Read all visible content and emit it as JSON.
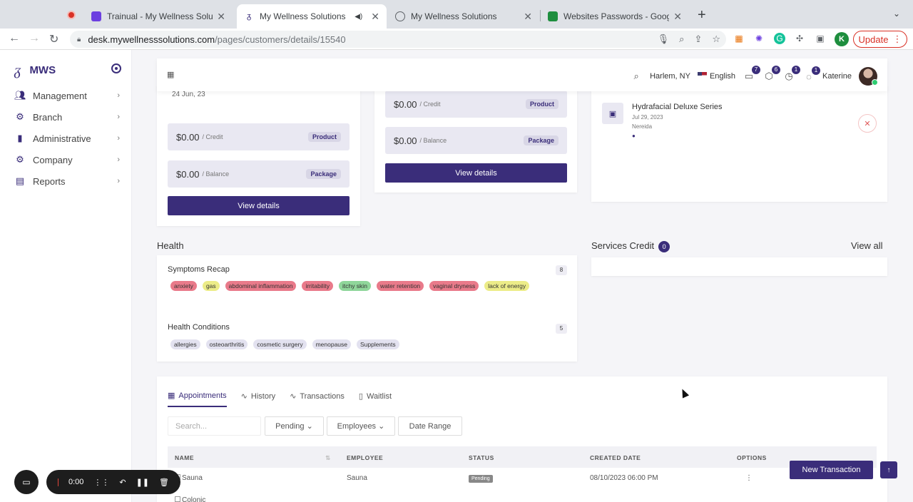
{
  "browser": {
    "tabs": [
      {
        "title": "Trainual - My Wellness Solution",
        "favicon_color": "#6c3fe0"
      },
      {
        "title": "My Wellness Solutions",
        "favicon_color": "#3a2d7a"
      },
      {
        "title": "My Wellness Solutions",
        "favicon_color": "#5f6368"
      },
      {
        "title": "Websites Passwords - Google",
        "favicon_color": "#1e8e3e"
      }
    ],
    "url_host": "desk.mywellnesssolutions.com",
    "url_path": "/pages/customers/details/15540",
    "profile_initial": "K",
    "update_label": "Update"
  },
  "sidebar": {
    "brand": "MWS",
    "items": [
      {
        "label": "Management",
        "icon": "users-icon"
      },
      {
        "label": "Branch",
        "icon": "gear-icon"
      },
      {
        "label": "Administrative",
        "icon": "bookmark-icon"
      },
      {
        "label": "Company",
        "icon": "cogs-icon"
      },
      {
        "label": "Reports",
        "icon": "report-icon"
      }
    ]
  },
  "header": {
    "location": "Harlem, NY",
    "language": "English",
    "badges": [
      "7",
      "6",
      "1",
      "1"
    ],
    "user": "Katerine"
  },
  "cards": {
    "left": {
      "date": "24 Jun, 23",
      "credit_amount": "$0.00",
      "credit_label": "/ Credit",
      "credit_pill": "Product",
      "balance_amount": "$0.00",
      "balance_label": "/ Balance",
      "balance_pill": "Package",
      "button": "View details"
    },
    "middle": {
      "credit_amount": "$0.00",
      "credit_label": "/ Credit",
      "credit_pill": "Product",
      "balance_amount": "$0.00",
      "balance_label": "/ Balance",
      "balance_pill": "Package",
      "button": "View details"
    },
    "right": {
      "item_title": "Hydrafacial Deluxe Series",
      "item_date": "Jul 29, 2023",
      "item_by": "Nereida",
      "close": "✕"
    }
  },
  "health": {
    "title": "Health",
    "symptoms_title": "Symptoms Recap",
    "symptoms_count": "8",
    "symptoms": [
      {
        "label": "anxiety",
        "color": "red"
      },
      {
        "label": "gas",
        "color": "yellow"
      },
      {
        "label": "abdominal inflammation",
        "color": "red"
      },
      {
        "label": "irritability",
        "color": "red"
      },
      {
        "label": "itchy skin",
        "color": "green"
      },
      {
        "label": "water retention",
        "color": "red"
      },
      {
        "label": "vaginal dryness",
        "color": "red"
      },
      {
        "label": "lack of energy",
        "color": "yellow"
      }
    ],
    "conditions_title": "Health Conditions",
    "conditions_count": "5",
    "conditions": [
      "allergies",
      "osteoarthritis",
      "cosmetic surgery",
      "menopause",
      "Supplements"
    ]
  },
  "services_credit": {
    "title": "Services Credit",
    "count": "0",
    "view_all": "View all"
  },
  "appointments": {
    "tabs": [
      "Appointments",
      "History",
      "Transactions",
      "Waitlist"
    ],
    "search_placeholder": "Search...",
    "filters": {
      "pending": "Pending",
      "employees": "Employees",
      "date_range": "Date Range"
    },
    "columns": [
      "NAME",
      "EMPLOYEE",
      "STATUS",
      "CREATED DATE",
      "OPTIONS"
    ],
    "rows": [
      {
        "name": "Sauna",
        "employee": "Sauna",
        "status": "Pending",
        "created": "08/10/2023 06:00 PM",
        "options": "⋮"
      },
      {
        "name": "Colonic",
        "employee": "",
        "status": "",
        "created": "",
        "options": ""
      }
    ],
    "new_transaction": "New Transaction"
  },
  "recorder": {
    "time": "0:00"
  },
  "colors": {
    "brand": "#3a2d7a",
    "tag_red": "#e97a8a",
    "tag_yellow": "#ecec88",
    "tag_green": "#8fd69a"
  }
}
